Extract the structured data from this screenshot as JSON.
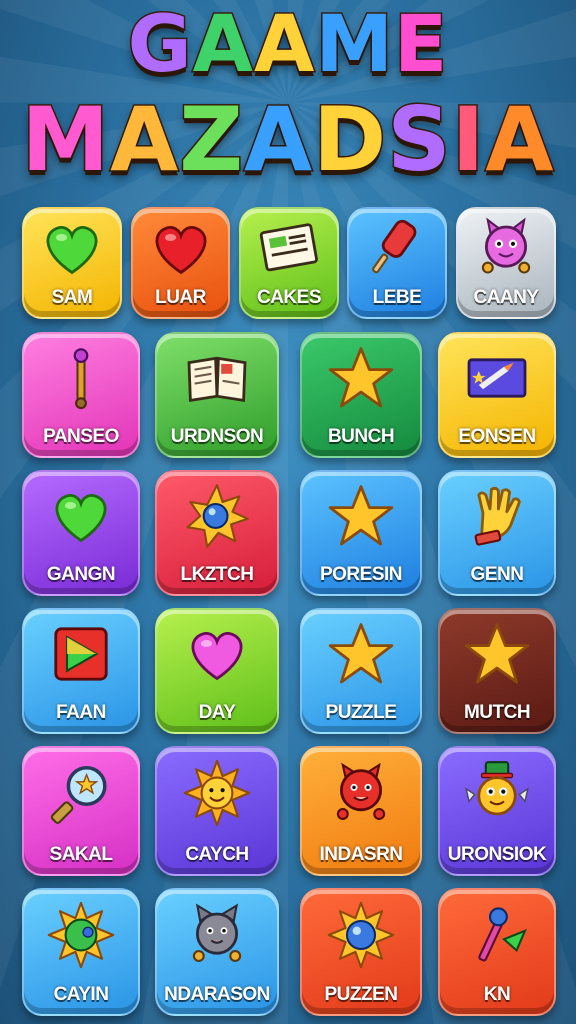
{
  "title": {
    "line1": "GAAME",
    "line2": "MAZADSIA"
  },
  "title_colors": {
    "line1": [
      "#b06cff",
      "#3fd26b",
      "#ffd23a",
      "#3aa0ff",
      "#ff4fd0"
    ],
    "line2": [
      "#ff5ad0",
      "#ffb83a",
      "#6ce05a",
      "#3aa0ff",
      "#ffd23a",
      "#b06cff",
      "#ff5a7a",
      "#ff8a2a"
    ]
  },
  "tiles": [
    {
      "label": "SAM",
      "icon": "green-heart-icon"
    },
    {
      "label": "LUAR",
      "icon": "red-heart-icon"
    },
    {
      "label": "CAKES",
      "icon": "newspaper-icon"
    },
    {
      "label": "LEBE",
      "icon": "popsicle-icon"
    },
    {
      "label": "CAANY",
      "icon": "pink-creature-icon"
    },
    {
      "label": "PANSEO",
      "icon": "wand-icon"
    },
    {
      "label": "URDNSON",
      "icon": "open-book-icon"
    },
    {
      "label": "BUNCH",
      "icon": "star-icon"
    },
    {
      "label": "EONSEN",
      "icon": "card-icon"
    },
    {
      "label": "GANGN",
      "icon": "green-heart-icon"
    },
    {
      "label": "LKZTCH",
      "icon": "sun-orb-icon"
    },
    {
      "label": "PORESIN",
      "icon": "star-icon"
    },
    {
      "label": "GENN",
      "icon": "glove-icon"
    },
    {
      "label": "FAAN",
      "icon": "play-icon"
    },
    {
      "label": "DAY",
      "icon": "pink-heart-icon"
    },
    {
      "label": "PUZZLE",
      "icon": "star-icon"
    },
    {
      "label": "MUTCH",
      "icon": "star-icon"
    },
    {
      "label": "SAKAL",
      "icon": "magnifier-icon"
    },
    {
      "label": "CAYCH",
      "icon": "smiling-sun-icon"
    },
    {
      "label": "INDASRN",
      "icon": "red-creature-icon"
    },
    {
      "label": "URONSIOK",
      "icon": "hat-creature-icon"
    },
    {
      "label": "CAYIN",
      "icon": "green-sun-icon"
    },
    {
      "label": "NDARASON",
      "icon": "gray-cat-icon"
    },
    {
      "label": "PUZZEN",
      "icon": "blue-orb-sun-icon"
    },
    {
      "label": "KN",
      "icon": "wand-arrow-icon"
    }
  ]
}
